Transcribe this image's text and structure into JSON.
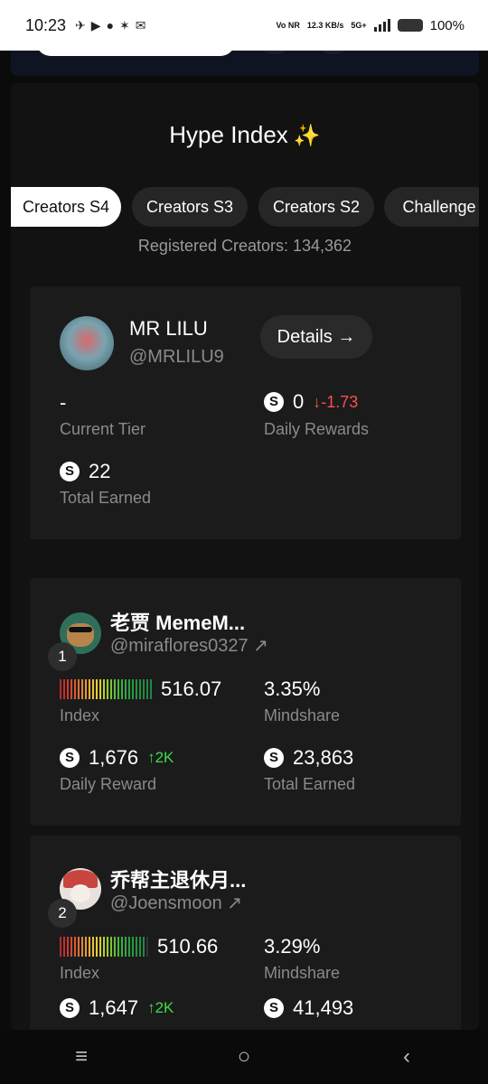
{
  "status_bar": {
    "time": "10:23",
    "network": "Vo NR",
    "speed": "12.3 KB/s",
    "gen": "5G+",
    "battery": "100%"
  },
  "panel": {
    "title": "Hype Index",
    "tabs": [
      "Creators S4",
      "Creators S3",
      "Creators S2",
      "Challenge"
    ],
    "registered": "Registered Creators: 134,362"
  },
  "my_card": {
    "name": "MR LILU",
    "handle": "@MRLILU9",
    "details_label": "Details →",
    "tier_value": "-",
    "tier_label": "Current Tier",
    "daily_value": "0",
    "daily_change": "↓-1.73",
    "daily_label": "Daily Rewards",
    "total_value": "22",
    "total_label": "Total Earned"
  },
  "leaderboard": [
    {
      "rank": "1",
      "name": "老贾 MemeM...",
      "handle": "@miraflores0327",
      "index_value": "516.07",
      "index_label": "Index",
      "mindshare_value": "3.35%",
      "mindshare_label": "Mindshare",
      "daily_reward_value": "1,676",
      "daily_reward_change": "↑2K",
      "daily_reward_label": "Daily Reward",
      "total_earned_value": "23,863",
      "total_earned_label": "Total Earned"
    },
    {
      "rank": "2",
      "name": "乔帮主退休月...",
      "handle": "@Joensmoon",
      "index_value": "510.66",
      "index_label": "Index",
      "mindshare_value": "3.29%",
      "mindshare_label": "Mindshare",
      "daily_reward_value": "1,647",
      "daily_reward_change": "↑2K",
      "total_earned_value": "41,493"
    }
  ],
  "icons": {
    "coin": "coin-icon",
    "external": "arrow-up-right-icon",
    "sparkle": "sparkle-icon"
  },
  "colors": {
    "accent_purple": "#b07cff",
    "down_red": "#ff4d4d",
    "up_green": "#3ddc4a"
  },
  "nav": {
    "back": "‹",
    "home": "○",
    "menu": "≡"
  }
}
